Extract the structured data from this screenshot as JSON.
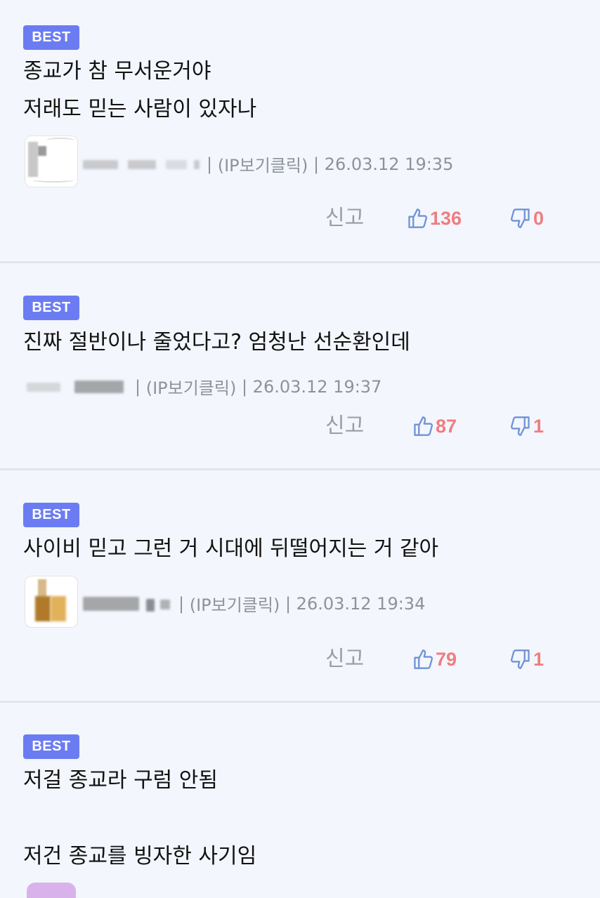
{
  "report_label": "신고",
  "comments": [
    {
      "badge": "BEST",
      "text": "종교가 참 무서운거야\n저래도 믿는 사람이 있자나",
      "ip_label": "(IP보기클릭)",
      "timestamp": "26.03.12 19:35",
      "likes": "136",
      "dislikes": "0"
    },
    {
      "badge": "BEST",
      "text": "진짜 절반이나 줄었다고? 엄청난 선순환인데",
      "ip_label": "(IP보기클릭)",
      "timestamp": "26.03.12 19:37",
      "likes": "87",
      "dislikes": "1"
    },
    {
      "badge": "BEST",
      "text": "사이비 믿고 그런 거 시대에 뒤떨어지는 거 같아",
      "ip_label": "(IP보기클릭)",
      "timestamp": "26.03.12 19:34",
      "likes": "79",
      "dislikes": "1"
    },
    {
      "badge": "BEST",
      "text": "저걸 종교라 구럼 안됨\n\n저건 종교를 빙자한 사기임"
    }
  ],
  "colors": {
    "badge": "#6b7cf2",
    "vote_count": "#ef7d80",
    "icon": "#6f93d8"
  }
}
